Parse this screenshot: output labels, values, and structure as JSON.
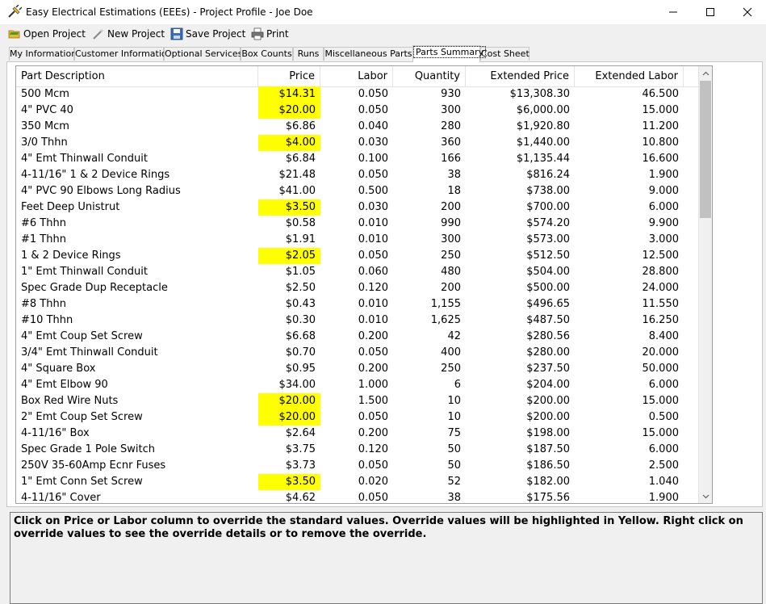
{
  "window": {
    "title": "Easy Electrical Estimations (EEEs) - Project Profile - Joe Doe"
  },
  "toolbar": {
    "open_label": "Open Project",
    "new_label": "New Project",
    "save_label": "Save Project",
    "print_label": "Print"
  },
  "tabs": [
    {
      "label": "My Information"
    },
    {
      "label": "Customer Information"
    },
    {
      "label": "Optional Services"
    },
    {
      "label": "Box Counts"
    },
    {
      "label": "Runs"
    },
    {
      "label": "Miscellaneous Parts"
    },
    {
      "label": "Parts Summary"
    },
    {
      "label": "Cost Sheet"
    }
  ],
  "active_tab": "Parts Summary",
  "colors": {
    "override_highlight": "#ffff00"
  },
  "table": {
    "headers": [
      "Part Description",
      "Price",
      "Labor",
      "Quantity",
      "Extended Price",
      "Extended Labor"
    ],
    "rows": [
      {
        "desc": "500 Mcm",
        "price": "$14.31",
        "labor": "0.050",
        "qty": "930",
        "ext_price": "$13,308.30",
        "ext_labor": "46.500",
        "override": true
      },
      {
        "desc": "4\" PVC 40",
        "price": "$20.00",
        "labor": "0.050",
        "qty": "300",
        "ext_price": "$6,000.00",
        "ext_labor": "15.000",
        "override": true
      },
      {
        "desc": "350 Mcm",
        "price": "$6.86",
        "labor": "0.040",
        "qty": "280",
        "ext_price": "$1,920.80",
        "ext_labor": "11.200",
        "override": false
      },
      {
        "desc": "3/0 Thhn",
        "price": "$4.00",
        "labor": "0.030",
        "qty": "360",
        "ext_price": "$1,440.00",
        "ext_labor": "10.800",
        "override": true
      },
      {
        "desc": "4\" Emt Thinwall Conduit",
        "price": "$6.84",
        "labor": "0.100",
        "qty": "166",
        "ext_price": "$1,135.44",
        "ext_labor": "16.600",
        "override": false
      },
      {
        "desc": "4-11/16\" 1 & 2 Device Rings",
        "price": "$21.48",
        "labor": "0.050",
        "qty": "38",
        "ext_price": "$816.24",
        "ext_labor": "1.900",
        "override": false
      },
      {
        "desc": "4\" PVC 90 Elbows Long Radius",
        "price": "$41.00",
        "labor": "0.500",
        "qty": "18",
        "ext_price": "$738.00",
        "ext_labor": "9.000",
        "override": false
      },
      {
        "desc": "Feet Deep Unistrut",
        "price": "$3.50",
        "labor": "0.030",
        "qty": "200",
        "ext_price": "$700.00",
        "ext_labor": "6.000",
        "override": true
      },
      {
        "desc": "#6 Thhn",
        "price": "$0.58",
        "labor": "0.010",
        "qty": "990",
        "ext_price": "$574.20",
        "ext_labor": "9.900",
        "override": false
      },
      {
        "desc": "#1 Thhn",
        "price": "$1.91",
        "labor": "0.010",
        "qty": "300",
        "ext_price": "$573.00",
        "ext_labor": "3.000",
        "override": false
      },
      {
        "desc": "1 & 2 Device Rings",
        "price": "$2.05",
        "labor": "0.050",
        "qty": "250",
        "ext_price": "$512.50",
        "ext_labor": "12.500",
        "override": true
      },
      {
        "desc": "1\" Emt Thinwall Conduit",
        "price": "$1.05",
        "labor": "0.060",
        "qty": "480",
        "ext_price": "$504.00",
        "ext_labor": "28.800",
        "override": false
      },
      {
        "desc": "Spec Grade Dup Receptacle",
        "price": "$2.50",
        "labor": "0.120",
        "qty": "200",
        "ext_price": "$500.00",
        "ext_labor": "24.000",
        "override": false
      },
      {
        "desc": "#8 Thhn",
        "price": "$0.43",
        "labor": "0.010",
        "qty": "1,155",
        "ext_price": "$496.65",
        "ext_labor": "11.550",
        "override": false
      },
      {
        "desc": "#10 Thhn",
        "price": "$0.30",
        "labor": "0.010",
        "qty": "1,625",
        "ext_price": "$487.50",
        "ext_labor": "16.250",
        "override": false
      },
      {
        "desc": "4\" Emt Coup Set Screw",
        "price": "$6.68",
        "labor": "0.200",
        "qty": "42",
        "ext_price": "$280.56",
        "ext_labor": "8.400",
        "override": false
      },
      {
        "desc": "3/4\" Emt Thinwall Conduit",
        "price": "$0.70",
        "labor": "0.050",
        "qty": "400",
        "ext_price": "$280.00",
        "ext_labor": "20.000",
        "override": false
      },
      {
        "desc": "4\" Square Box",
        "price": "$0.95",
        "labor": "0.200",
        "qty": "250",
        "ext_price": "$237.50",
        "ext_labor": "50.000",
        "override": false
      },
      {
        "desc": "4\" Emt Elbow 90",
        "price": "$34.00",
        "labor": "1.000",
        "qty": "6",
        "ext_price": "$204.00",
        "ext_labor": "6.000",
        "override": false
      },
      {
        "desc": "Box Red Wire Nuts",
        "price": "$20.00",
        "labor": "1.500",
        "qty": "10",
        "ext_price": "$200.00",
        "ext_labor": "15.000",
        "override": true
      },
      {
        "desc": "2\" Emt Coup Set Screw",
        "price": "$20.00",
        "labor": "0.050",
        "qty": "10",
        "ext_price": "$200.00",
        "ext_labor": "0.500",
        "override": true
      },
      {
        "desc": "4-11/16\" Box",
        "price": "$2.64",
        "labor": "0.200",
        "qty": "75",
        "ext_price": "$198.00",
        "ext_labor": "15.000",
        "override": false
      },
      {
        "desc": "Spec Grade 1 Pole Switch",
        "price": "$3.75",
        "labor": "0.120",
        "qty": "50",
        "ext_price": "$187.50",
        "ext_labor": "6.000",
        "override": false
      },
      {
        "desc": "250V 35-60Amp Ecnr Fuses",
        "price": "$3.73",
        "labor": "0.050",
        "qty": "50",
        "ext_price": "$186.50",
        "ext_labor": "2.500",
        "override": false
      },
      {
        "desc": "1\" Emt Conn Set Screw",
        "price": "$3.50",
        "labor": "0.020",
        "qty": "52",
        "ext_price": "$182.00",
        "ext_labor": "1.040",
        "override": true
      },
      {
        "desc": "4-11/16\" Cover",
        "price": "$4.62",
        "labor": "0.050",
        "qty": "38",
        "ext_price": "$175.56",
        "ext_labor": "1.900",
        "override": false
      }
    ]
  },
  "message": "Click on Price or Labor column to override the standard values.  Override values will be highlighted in Yellow.  Right click on override values to see the override details or to remove the override."
}
